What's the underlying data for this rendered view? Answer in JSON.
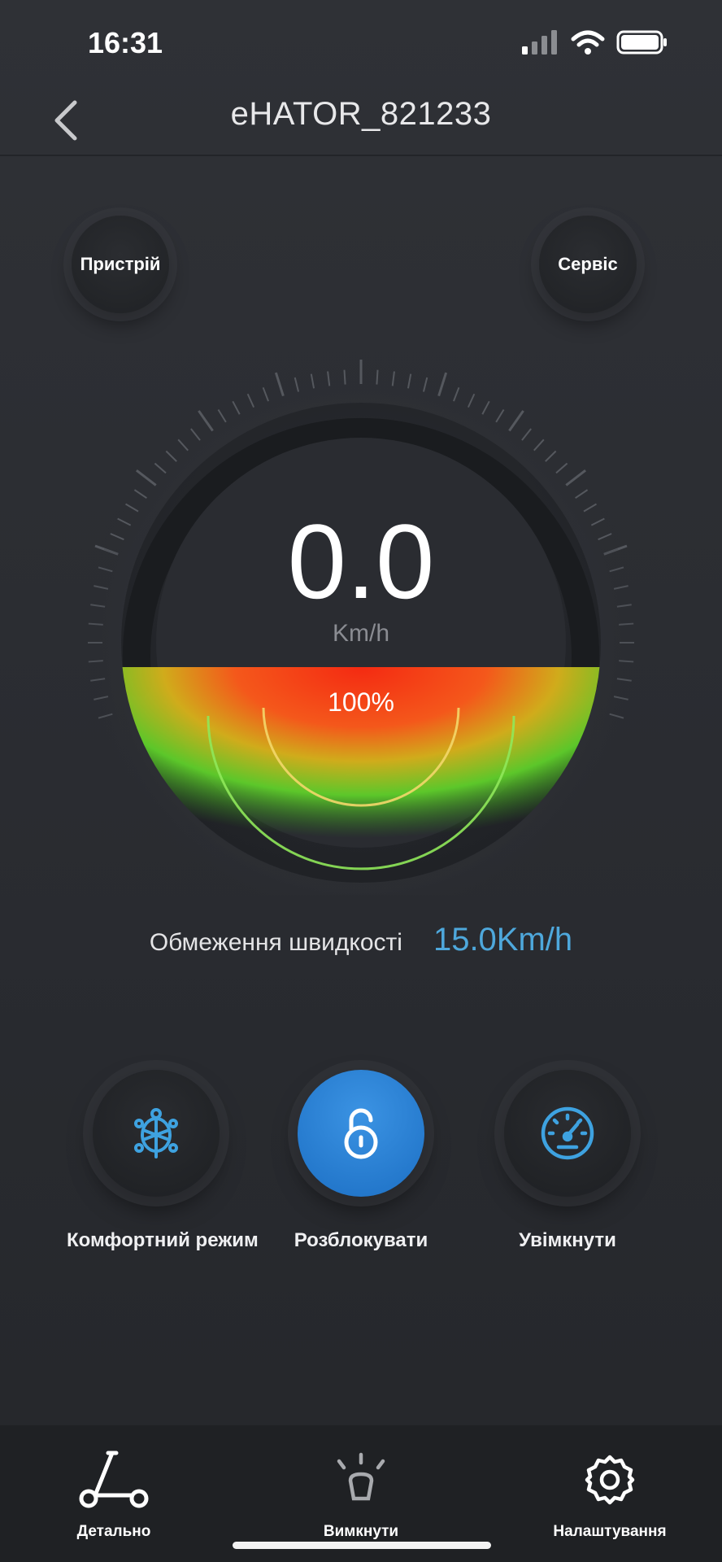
{
  "status_bar": {
    "time": "16:31"
  },
  "nav": {
    "title": "eHATOR_821233"
  },
  "corner_buttons": {
    "device": "Пристрій",
    "service": "Сервіс"
  },
  "speedometer": {
    "speed": "0.0",
    "unit": "Km/h",
    "battery": "100%",
    "battery_level": 1.0
  },
  "speed_limit": {
    "label": "Обмеження швидкості",
    "value": "15.0Km/h"
  },
  "actions": [
    {
      "label": "Комфортний режим",
      "icon": "turtle-icon"
    },
    {
      "label": "Розблокувати",
      "icon": "unlock-icon"
    },
    {
      "label": "Увімкнути",
      "icon": "speedometer-icon"
    }
  ],
  "tabs": [
    {
      "label": "Детально",
      "icon": "scooter-icon"
    },
    {
      "label": "Вимкнути",
      "icon": "headlight-icon"
    },
    {
      "label": "Налаштування",
      "icon": "gear-icon"
    }
  ],
  "colors": {
    "accent": "#4ea8dc",
    "active_button": "#2a82d6",
    "background": "#2b2d32"
  }
}
